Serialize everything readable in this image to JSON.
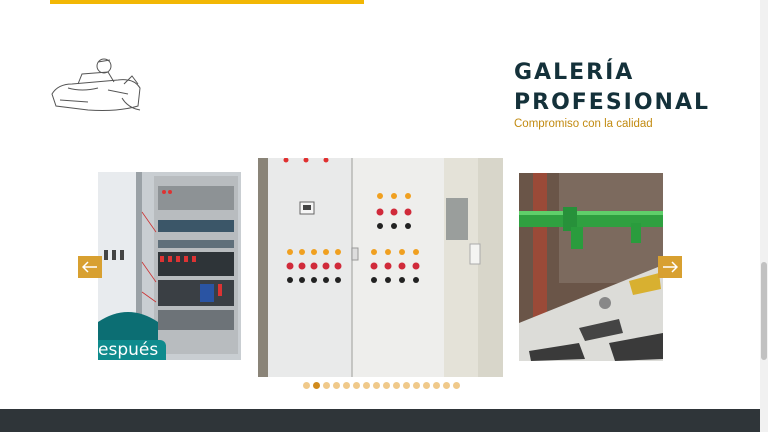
{
  "section": {
    "title_line1": "GALERÍA",
    "title_line2": "PROFESIONAL",
    "subtitle": "Compromiso con la calidad"
  },
  "gallery": {
    "left_caption": "espués",
    "slide_count": 16,
    "active_index": 1,
    "prev_icon": "arrow-left-icon",
    "next_icon": "arrow-right-icon"
  },
  "colors": {
    "accent": "#f2b705",
    "nav": "#d8a030",
    "title": "#14313a",
    "subtitle": "#c28b12",
    "footer": "#2f3539"
  }
}
